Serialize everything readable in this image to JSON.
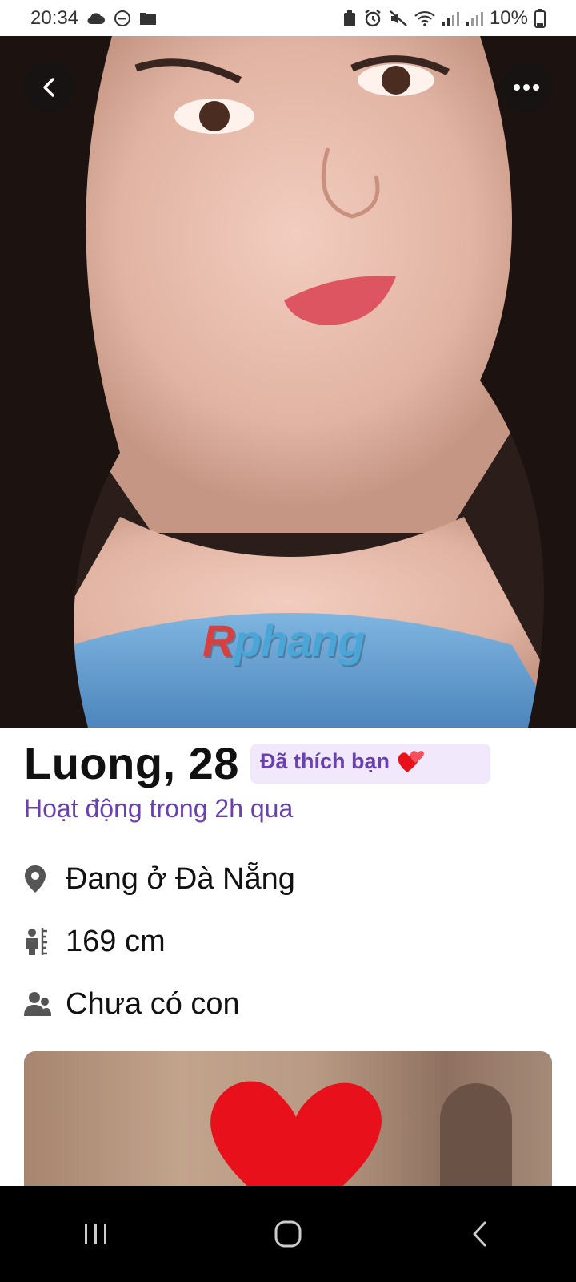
{
  "status_bar": {
    "time": "20:34",
    "battery": "10%",
    "icons_left": [
      "cloud-icon",
      "do-not-disturb-icon",
      "folder-icon"
    ],
    "icons_right": [
      "recycle-icon",
      "alarm-icon",
      "mute-icon",
      "wifi-icon",
      "signal-icon",
      "signal-icon",
      "battery-icon"
    ]
  },
  "photo": {
    "watermark": "Rphang",
    "back_icon": "chevron-left-icon",
    "more_icon": "more-horizontal-icon"
  },
  "profile": {
    "name_age": "Luong, 28",
    "liked_badge": "Đã thích bạn",
    "active_status": "Hoạt động trong 2h qua",
    "details": [
      {
        "icon": "location-pin-icon",
        "text": "Đang ở Đà Nẵng"
      },
      {
        "icon": "height-icon",
        "text": "169 cm"
      },
      {
        "icon": "children-icon",
        "text": "Chưa có con"
      }
    ]
  },
  "nav_bar": {
    "icons": [
      "recent-apps-icon",
      "home-icon",
      "back-icon"
    ]
  },
  "colors": {
    "accent_purple": "#6a3fb0",
    "badge_background": "#f1e8fb",
    "heart_red": "#e8101a"
  }
}
